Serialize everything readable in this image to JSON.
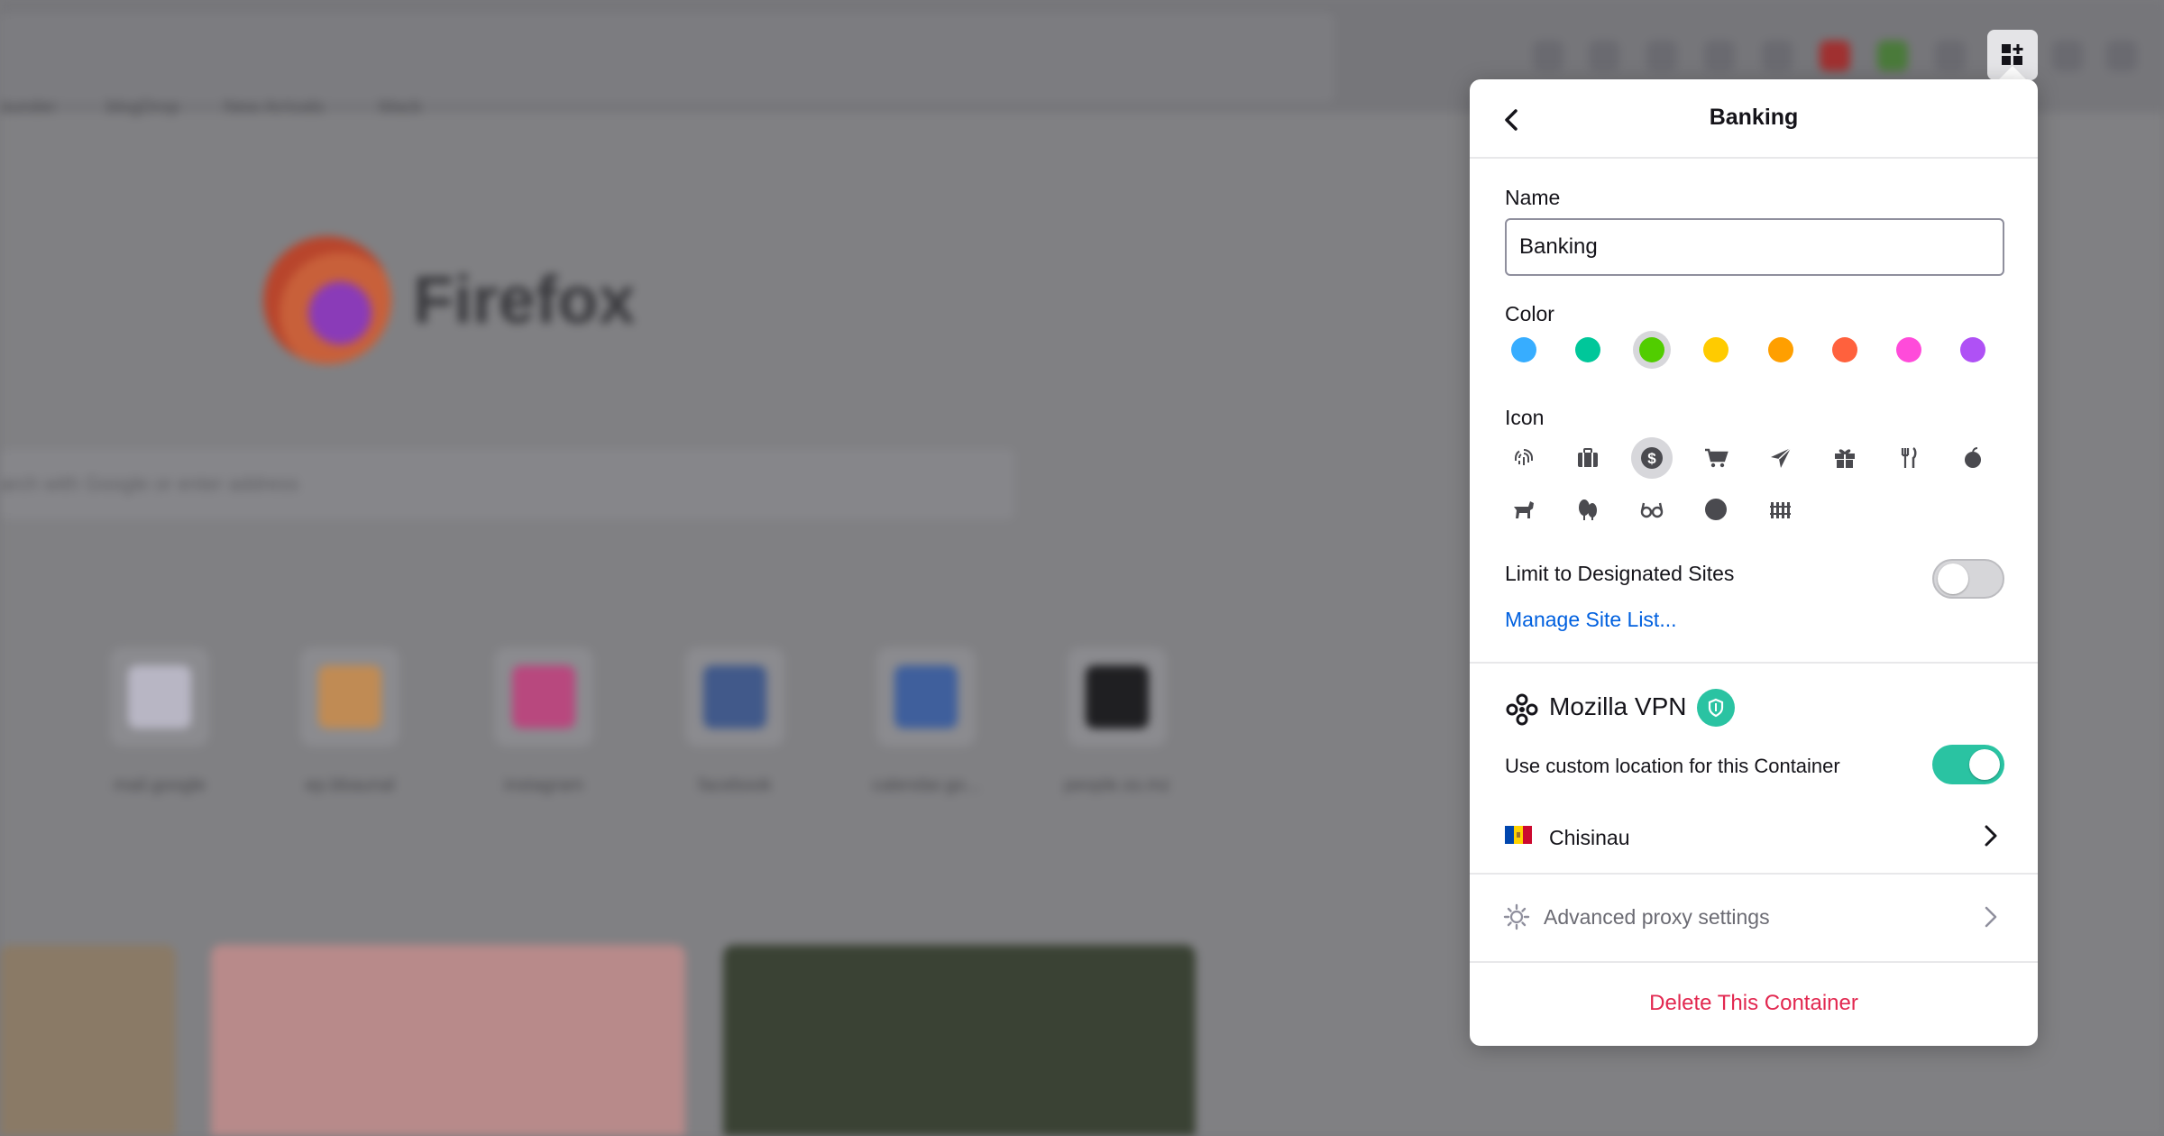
{
  "background": {
    "bookmarks": [
      "ounder",
      "blogDrop",
      "New Arrivals",
      "Mack"
    ],
    "brand": "Firefox",
    "search_placeholder": "arch with Google or enter address",
    "tiles": [
      {
        "label": "mail.google",
        "color": "#b8b6c4"
      },
      {
        "label": "ep.bbaunal",
        "color": "#c08b54"
      },
      {
        "label": "instagram",
        "color": "#b8487e"
      },
      {
        "label": "facebook",
        "color": "#41598a"
      },
      {
        "label": "calendar.go...",
        "color": "#3f5f9c"
      },
      {
        "label": "people.ss.mz",
        "color": "#1f1f22"
      }
    ]
  },
  "toolbar": {
    "extension_icon": "containers-icon"
  },
  "panel": {
    "title": "Banking",
    "back_icon": "chevron-left-icon",
    "name_label": "Name",
    "name_value": "Banking",
    "color_label": "Color",
    "colors": [
      {
        "name": "blue",
        "hex": "#37adff",
        "selected": false
      },
      {
        "name": "turquoise",
        "hex": "#00c79a",
        "selected": false
      },
      {
        "name": "green",
        "hex": "#51cd00",
        "selected": true
      },
      {
        "name": "yellow",
        "hex": "#ffcb00",
        "selected": false
      },
      {
        "name": "orange",
        "hex": "#ff9f00",
        "selected": false
      },
      {
        "name": "red",
        "hex": "#ff613d",
        "selected": false
      },
      {
        "name": "pink",
        "hex": "#ff4bda",
        "selected": false
      },
      {
        "name": "purple",
        "hex": "#af51f5",
        "selected": false
      }
    ],
    "icon_label": "Icon",
    "icons": [
      {
        "name": "fingerprint",
        "selected": false
      },
      {
        "name": "briefcase",
        "selected": false
      },
      {
        "name": "dollar",
        "selected": true
      },
      {
        "name": "cart",
        "selected": false
      },
      {
        "name": "vacation",
        "selected": false
      },
      {
        "name": "gift",
        "selected": false
      },
      {
        "name": "food",
        "selected": false
      },
      {
        "name": "fruit",
        "selected": false
      },
      {
        "name": "pet",
        "selected": false
      },
      {
        "name": "tree",
        "selected": false
      },
      {
        "name": "chill",
        "selected": false
      },
      {
        "name": "circle",
        "selected": false
      },
      {
        "name": "fence",
        "selected": false
      }
    ],
    "limit_label": "Limit to Designated Sites",
    "limit_enabled": false,
    "manage_link": "Manage Site List...",
    "vpn": {
      "title": "Mozilla VPN",
      "custom_location_label": "Use custom location for this Container",
      "custom_location_enabled": true,
      "location": "Chisinau",
      "location_flag": "moldova-flag-icon"
    },
    "advanced_label": "Advanced proxy settings",
    "delete_label": "Delete This Container"
  }
}
